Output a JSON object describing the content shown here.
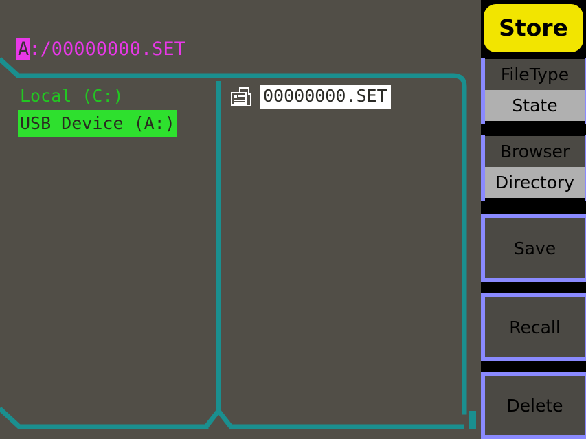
{
  "screen": {
    "background_color": "#514e47",
    "frame_color": "#1a8f8f"
  },
  "path_bar": {
    "name": "current-path",
    "cursor_char": "A",
    "rest": ":/00000000.SET",
    "full_text": "A:/00000000.SET",
    "text_color": "#e838e8"
  },
  "drive_panel": {
    "items": [
      {
        "label": "Local (C:)",
        "selected": false
      },
      {
        "label": "USB Device (A:)",
        "selected": true
      }
    ],
    "text_color": "#22c722",
    "highlight_color": "#2ee02e"
  },
  "file_panel": {
    "items": [
      {
        "name": "00000000.SET",
        "icon": "file-document-icon",
        "selected": true
      }
    ]
  },
  "sidebar": {
    "title": "Store",
    "title_color": "#f2e500",
    "accent_color": "#8a8aff",
    "softkeys": [
      {
        "type": "dual",
        "label": "FileType",
        "value": "State"
      },
      {
        "type": "dual",
        "label": "Browser",
        "value": "Directory"
      },
      {
        "type": "action",
        "label": "Save"
      },
      {
        "type": "action",
        "label": "Recall"
      },
      {
        "type": "action",
        "label": "Delete"
      }
    ]
  }
}
